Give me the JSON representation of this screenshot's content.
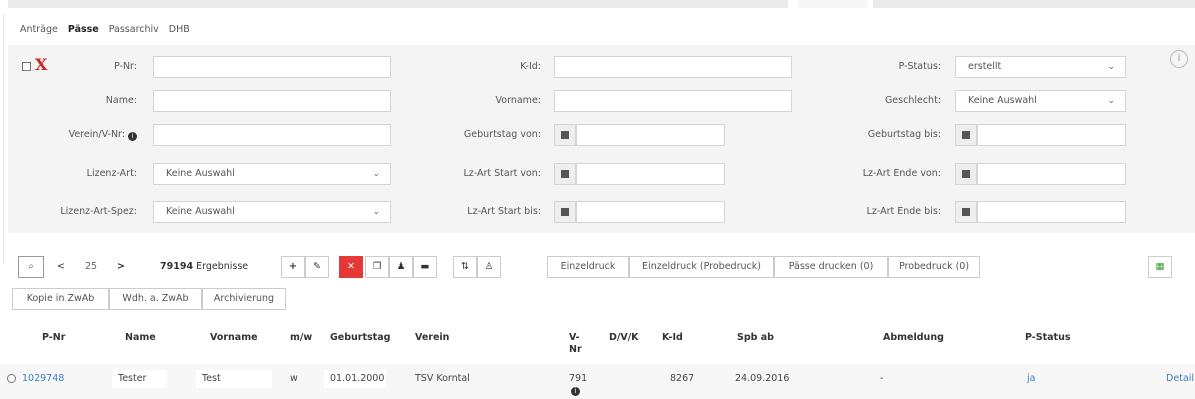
{
  "tabs": [
    "Anträge",
    "Pässe",
    "Passarchiv",
    "DHB"
  ],
  "filters": {
    "p_nr": "P-Nr:",
    "k_id": "K-Id:",
    "p_status": "P-Status:",
    "p_status_value": "erstellt",
    "name": "Name:",
    "vorname": "Vorname:",
    "geschlecht": "Geschlecht:",
    "geschlecht_value": "Keine Auswahl",
    "verein": "Verein/V-Nr:",
    "geb_von": "Geburtstag von:",
    "geb_bis": "Geburtstag bis:",
    "lizenz_art": "Lizenz-Art:",
    "lizenz_art_value": "Keine Auswahl",
    "lz_start_von": "Lz-Art Start von:",
    "lz_ende_von": "Lz-Art Ende von:",
    "lizenz_art_spez": "Lizenz-Art-Spez:",
    "lizenz_art_spez_value": "Keine Auswahl",
    "lz_start_bis": "Lz-Art Start bis:",
    "lz_ende_bis": "Lz-Art Ende bis:"
  },
  "toolbar": {
    "page_size": "25",
    "result_count": "79194",
    "result_label": "Ergebnisse",
    "einzeldruck": "Einzeldruck",
    "einzeldruck_probe": "Einzeldruck (Probedruck)",
    "paesse_drucken": "Pässe drucken (0)",
    "probedruck": "Probedruck (0)",
    "kopie": "Kopie in ZwAb",
    "wdh": "Wdh. a. ZwAb",
    "archivierung": "Archivierung"
  },
  "table": {
    "headers": [
      "P-Nr",
      "Name",
      "Vorname",
      "m/w",
      "Geburtstag",
      "Verein",
      "V-",
      "Nr",
      "D/V/K",
      "K-Id",
      "Spb ab",
      "Abmeldung",
      "P-Status"
    ],
    "row": {
      "p_nr": "1029748",
      "name": "Tester",
      "vorname": "Test",
      "mw": "w",
      "geburtstag": "01.01.2000",
      "verein": "TSV Korntal",
      "v_nr": "791",
      "k_id": "8267",
      "spb_ab": "24.09.2016",
      "abmeldung": "-",
      "p_status": "ja",
      "detail": "Detail"
    }
  }
}
